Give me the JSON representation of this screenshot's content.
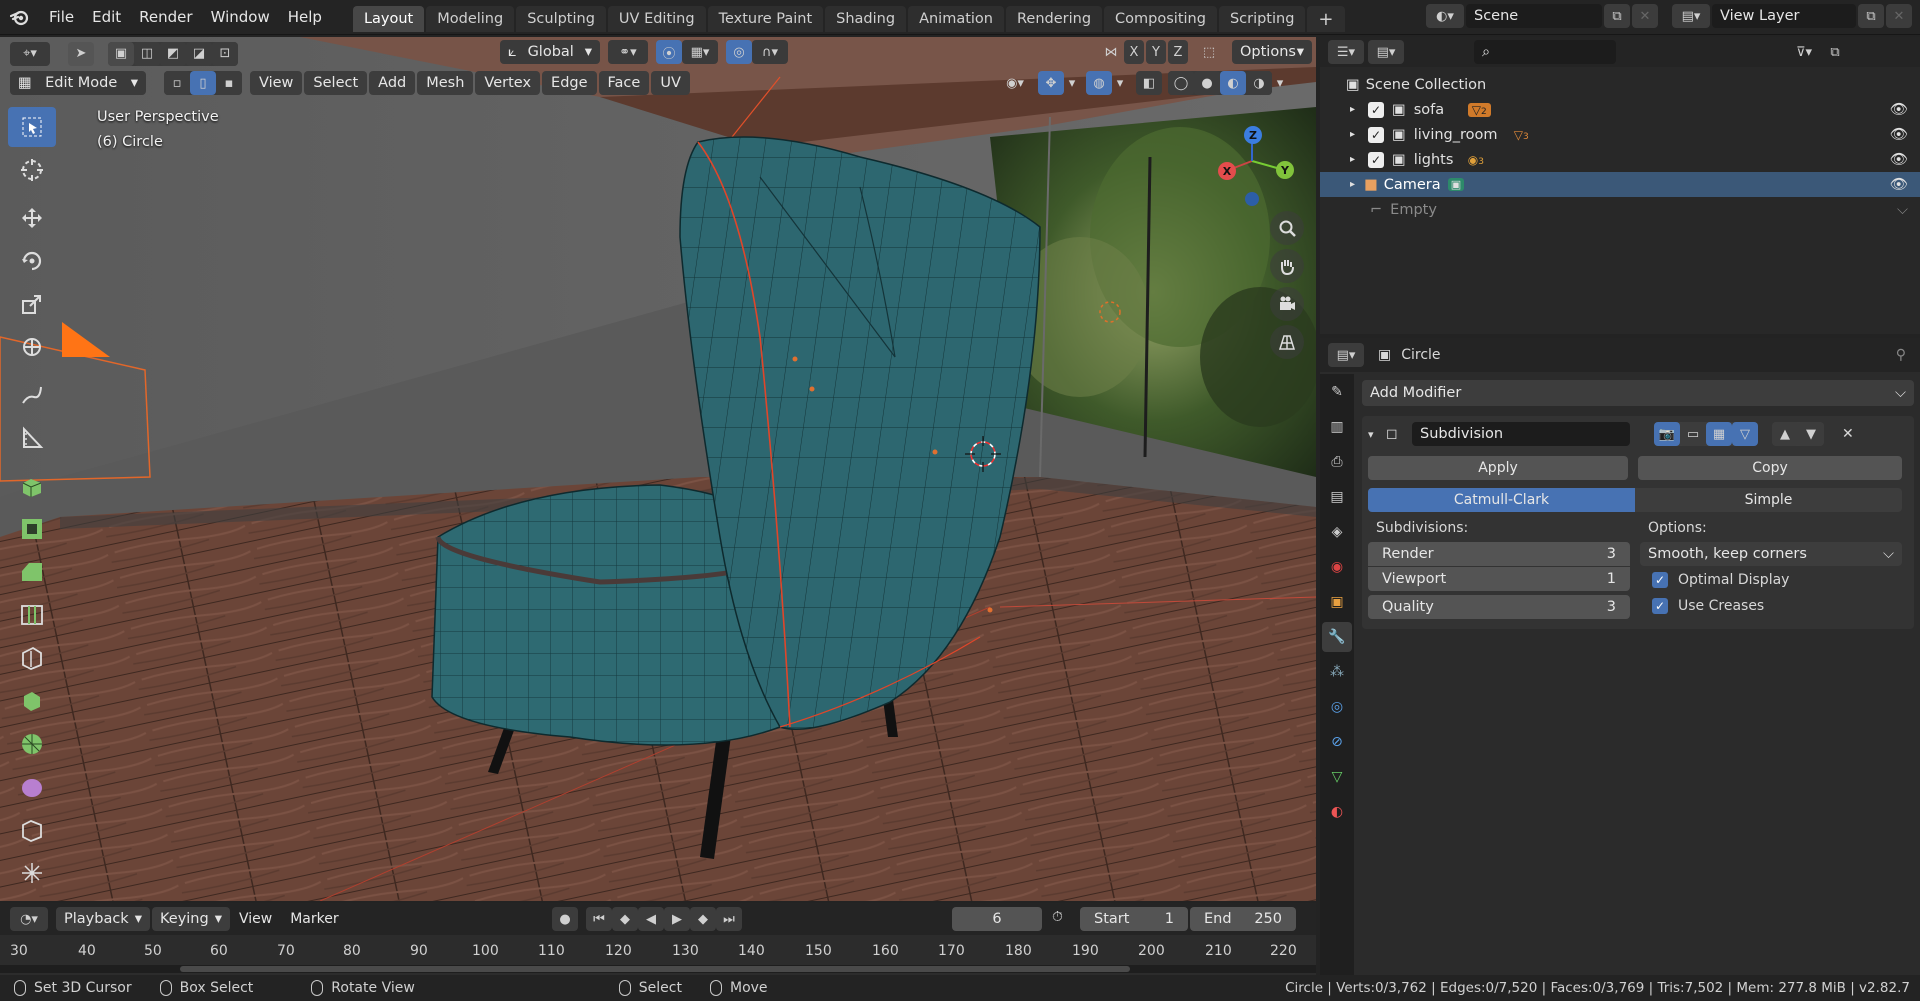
{
  "topbar": {
    "menus": [
      "File",
      "Edit",
      "Render",
      "Window",
      "Help"
    ],
    "workspaces": [
      "Layout",
      "Modeling",
      "Sculpting",
      "UV Editing",
      "Texture Paint",
      "Shading",
      "Animation",
      "Rendering",
      "Compositing",
      "Scripting"
    ],
    "active_workspace": "Layout",
    "scene": "Scene",
    "view_layer": "View Layer"
  },
  "viewport": {
    "orientation": "Global",
    "options_label": "Options",
    "mode": "Edit Mode",
    "menus": [
      "View",
      "Select",
      "Add",
      "Mesh",
      "Vertex",
      "Edge",
      "Face",
      "UV"
    ],
    "axes": [
      "X",
      "Y",
      "Z"
    ],
    "perspective": "User Perspective",
    "object_info": "(6) Circle",
    "gizmo": {
      "x": "X",
      "y": "Y",
      "z": "Z"
    }
  },
  "outliner": {
    "root": "Scene Collection",
    "items": [
      {
        "name": "sofa",
        "badge": "2"
      },
      {
        "name": "living_room",
        "badge": "3"
      },
      {
        "name": "lights",
        "badge": "3"
      },
      {
        "name": "Camera",
        "badge": ""
      },
      {
        "name": "Empty",
        "badge": ""
      }
    ]
  },
  "properties": {
    "object_name": "Circle",
    "add_modifier": "Add Modifier",
    "modifier_name": "Subdivision",
    "apply": "Apply",
    "copy": "Copy",
    "algorithms": [
      "Catmull-Clark",
      "Simple"
    ],
    "active_algorithm": "Catmull-Clark",
    "subdivisions_label": "Subdivisions:",
    "render_label": "Render",
    "render_value": "3",
    "viewport_label": "Viewport",
    "viewport_value": "1",
    "quality_label": "Quality",
    "quality_value": "3",
    "options_label": "Options:",
    "uv_smooth": "Smooth, keep corners",
    "optimal_display": "Optimal Display",
    "optimal_display_checked": true,
    "use_creases": "Use Creases",
    "use_creases_checked": true
  },
  "timeline": {
    "playback": "Playback",
    "keying": "Keying",
    "view": "View",
    "marker": "Marker",
    "current_frame": "6",
    "start_label": "Start",
    "start": "1",
    "end_label": "End",
    "end": "250",
    "ticks": [
      "30",
      "40",
      "50",
      "60",
      "70",
      "80",
      "90",
      "100",
      "110",
      "120",
      "130",
      "140",
      "150",
      "160",
      "170",
      "180",
      "190",
      "200",
      "210",
      "220"
    ]
  },
  "statusbar": {
    "set_cursor": "Set 3D Cursor",
    "box_select": "Box Select",
    "rotate_view": "Rotate View",
    "select": "Select",
    "move": "Move",
    "stats": "Circle | Verts:0/3,762 | Edges:0/7,520 | Faces:0/3,769 | Tris:7,502 | Mem: 277.8 MiB | v2.82.7"
  },
  "colors": {
    "accent": "#4772b3",
    "header": "#242424",
    "panel": "#2b2b2b",
    "fabric": "#2e6a72"
  }
}
